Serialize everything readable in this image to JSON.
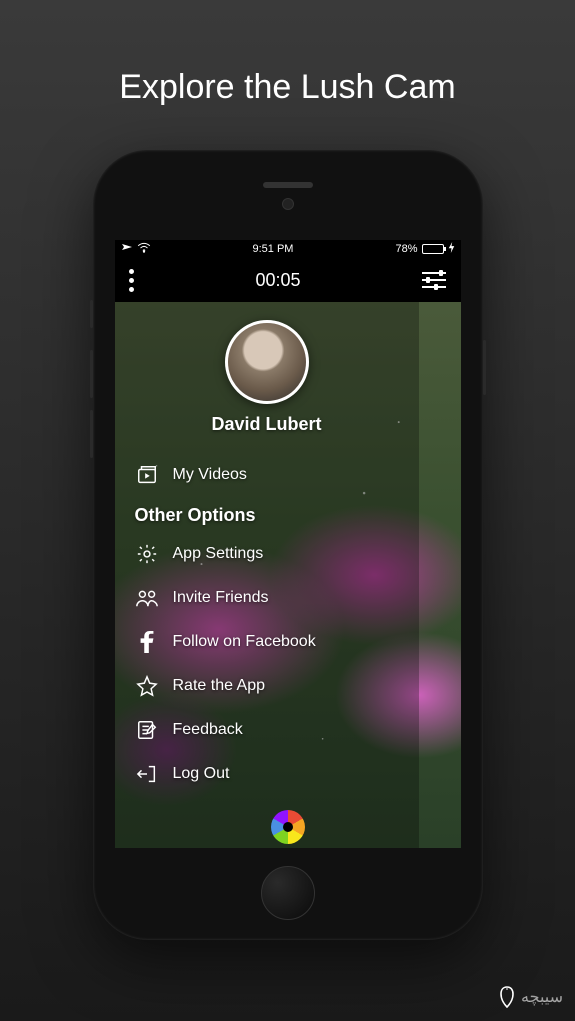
{
  "promo": {
    "title": "Explore the Lush Cam"
  },
  "statusbar": {
    "time": "9:51 PM",
    "battery_pct": "78%"
  },
  "toolbar": {
    "timer": "00:05"
  },
  "profile": {
    "username": "David Lubert"
  },
  "menu": {
    "my_videos": "My Videos",
    "section_other": "Other Options",
    "items": {
      "app_settings": "App Settings",
      "invite_friends": "Invite Friends",
      "follow_facebook": "Follow on Facebook",
      "rate_app": "Rate the App",
      "feedback": "Feedback",
      "logout": "Log Out"
    }
  },
  "watermark": {
    "text": "سیبچه"
  }
}
